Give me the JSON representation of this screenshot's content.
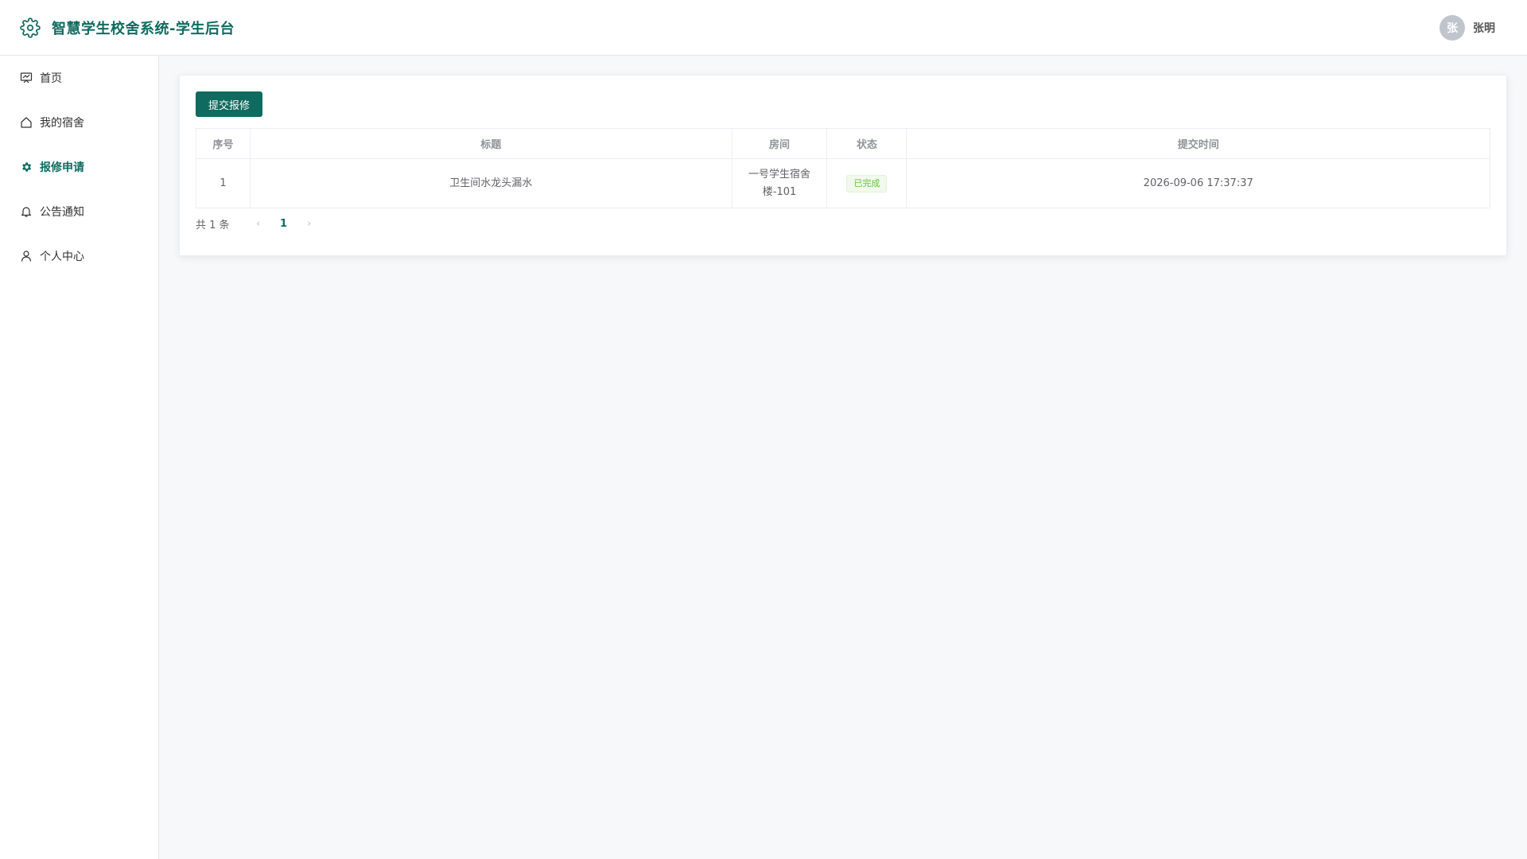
{
  "header": {
    "title": "智慧学生校舍系统-学生后台",
    "user": {
      "avatar_text": "张",
      "name": "张明"
    },
    "brand_icon": "gear-icon"
  },
  "sidebar": {
    "items": [
      {
        "label": "首页",
        "icon": "presentation-icon",
        "active": false
      },
      {
        "label": "我的宿舍",
        "icon": "home-icon",
        "active": false
      },
      {
        "label": "报修申请",
        "icon": "gear-icon",
        "active": true
      },
      {
        "label": "公告通知",
        "icon": "bell-icon",
        "active": false
      },
      {
        "label": "个人中心",
        "icon": "user-icon",
        "active": false
      }
    ]
  },
  "main": {
    "submit_button": "提交报修",
    "table": {
      "headers": [
        "序号",
        "标题",
        "房间",
        "状态",
        "提交时间"
      ],
      "rows": [
        {
          "index": "1",
          "title": "卫生间水龙头漏水",
          "room_line1": "一号学生宿舍",
          "room_line2": "楼-101",
          "status": "已完成",
          "time": "2026-09-06 17:37:37"
        }
      ]
    },
    "pagination": {
      "total": "共 1 条",
      "prev": "‹",
      "current": "1",
      "next": "›"
    }
  },
  "colors": {
    "accent": "#0f6b5f",
    "success": "#67c23a",
    "background": "#f7f8fa"
  }
}
